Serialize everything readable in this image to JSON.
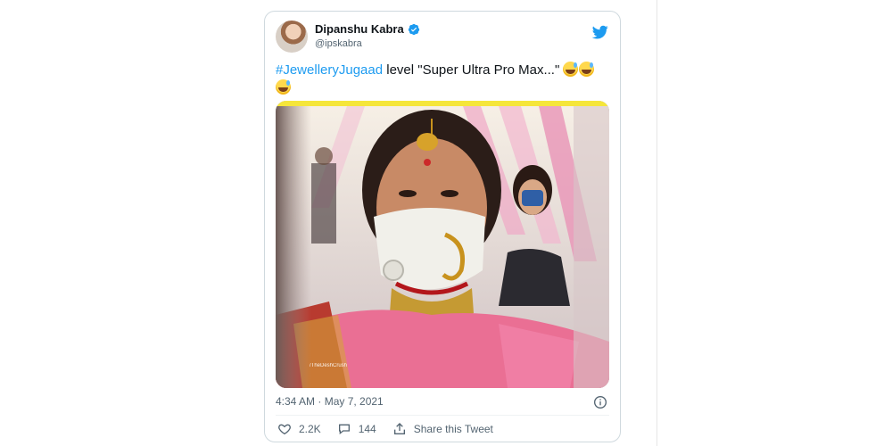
{
  "tweet": {
    "author_name": "Dipanshu Kabra",
    "author_handle": "@ipskabra",
    "hashtag": "#JewelleryJugaad",
    "text_after_hashtag": " level \"Super Ultra Pro Max...\"",
    "timestamp": "4:34 AM · May 7, 2021",
    "media_watermark": "/TheDeshCrush"
  },
  "actions": {
    "likes": "2.2K",
    "replies": "144",
    "share_label": "Share this Tweet"
  },
  "icons": {
    "verified": "verified-badge-icon",
    "twitter": "twitter-bird-icon",
    "info": "info-icon",
    "like": "heart-icon",
    "reply": "reply-bubble-icon",
    "share": "share-icon"
  },
  "colors": {
    "accent": "#1d9bf0",
    "text": "#0f1419",
    "muted": "#536471",
    "border": "#cfd9de"
  }
}
